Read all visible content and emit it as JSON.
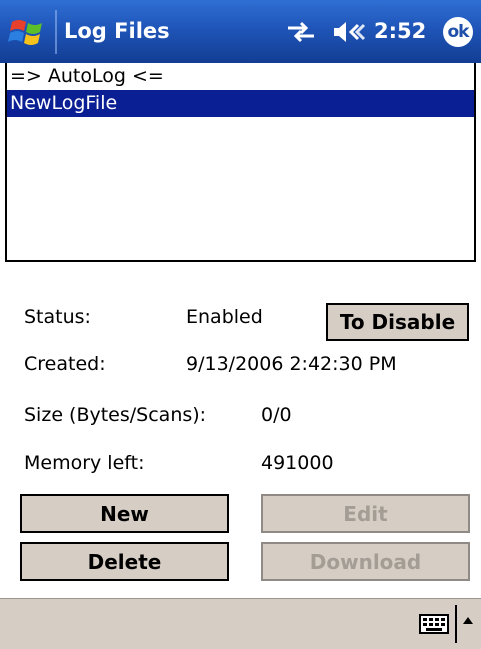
{
  "titlebar": {
    "title": "Log Files",
    "time": "2:52",
    "ok_label": "ok"
  },
  "list": {
    "items": [
      "=> AutoLog <=",
      "NewLogFile"
    ],
    "selected_index": 1
  },
  "details": {
    "status_label": "Status:",
    "status_value": "Enabled",
    "created_label": "Created:",
    "created_value": "9/13/2006 2:42:30 PM",
    "size_label": "Size (Bytes/Scans):",
    "size_value": "0/0",
    "memory_label": "Memory left:",
    "memory_value": "491000"
  },
  "buttons": {
    "toggle_label": "To Disable",
    "new_label": "New",
    "edit_label": "Edit",
    "delete_label": "Delete",
    "download_label": "Download"
  },
  "colors": {
    "titlebar": "#1f55b8",
    "selection": "#0a1f93",
    "button_face": "#d6cec5",
    "disabled_text": "#a39d96"
  },
  "icons": [
    "windows-start-icon",
    "connectivity-icon",
    "volume-icon",
    "keyboard-icon",
    "input-menu-arrow-icon"
  ]
}
